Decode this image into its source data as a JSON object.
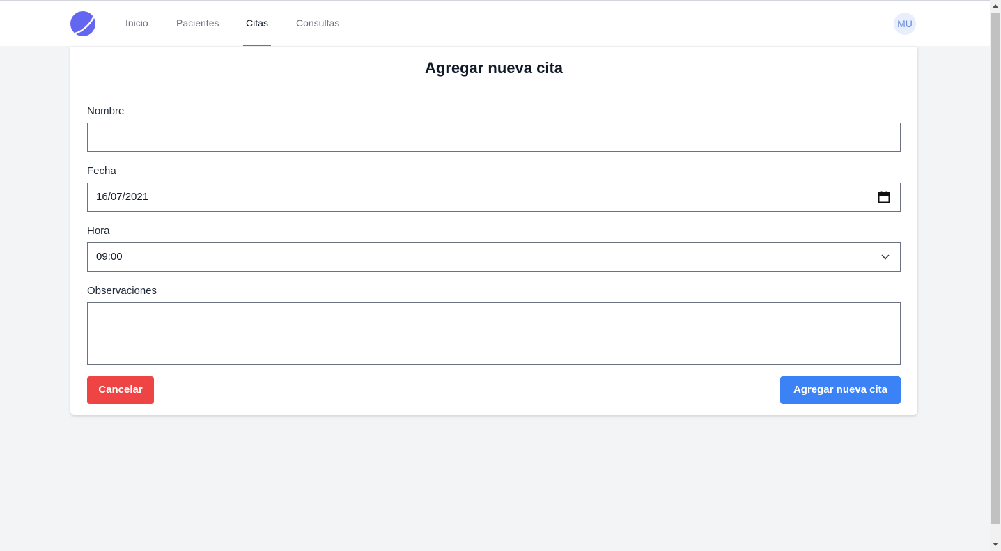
{
  "nav": {
    "logo_icon": "logo-circle-icon",
    "links": [
      "Inicio",
      "Pacientes",
      "Citas",
      "Consultas"
    ],
    "active": "Citas",
    "avatar_initials": "MU"
  },
  "form": {
    "title": "Agregar nueva cita",
    "nombre_label": "Nombre",
    "nombre_value": "",
    "fecha_label": "Fecha",
    "fecha_value": "16/07/2021",
    "hora_label": "Hora",
    "hora_value": "09:00",
    "observaciones_label": "Observaciones",
    "observaciones_value": "",
    "cancel_label": "Cancelar",
    "submit_label": "Agregar nueva cita"
  },
  "colors": {
    "accent": "#6366f1",
    "cancel": "#ef4444",
    "submit": "#3b82f6",
    "background": "#f3f4f6"
  }
}
